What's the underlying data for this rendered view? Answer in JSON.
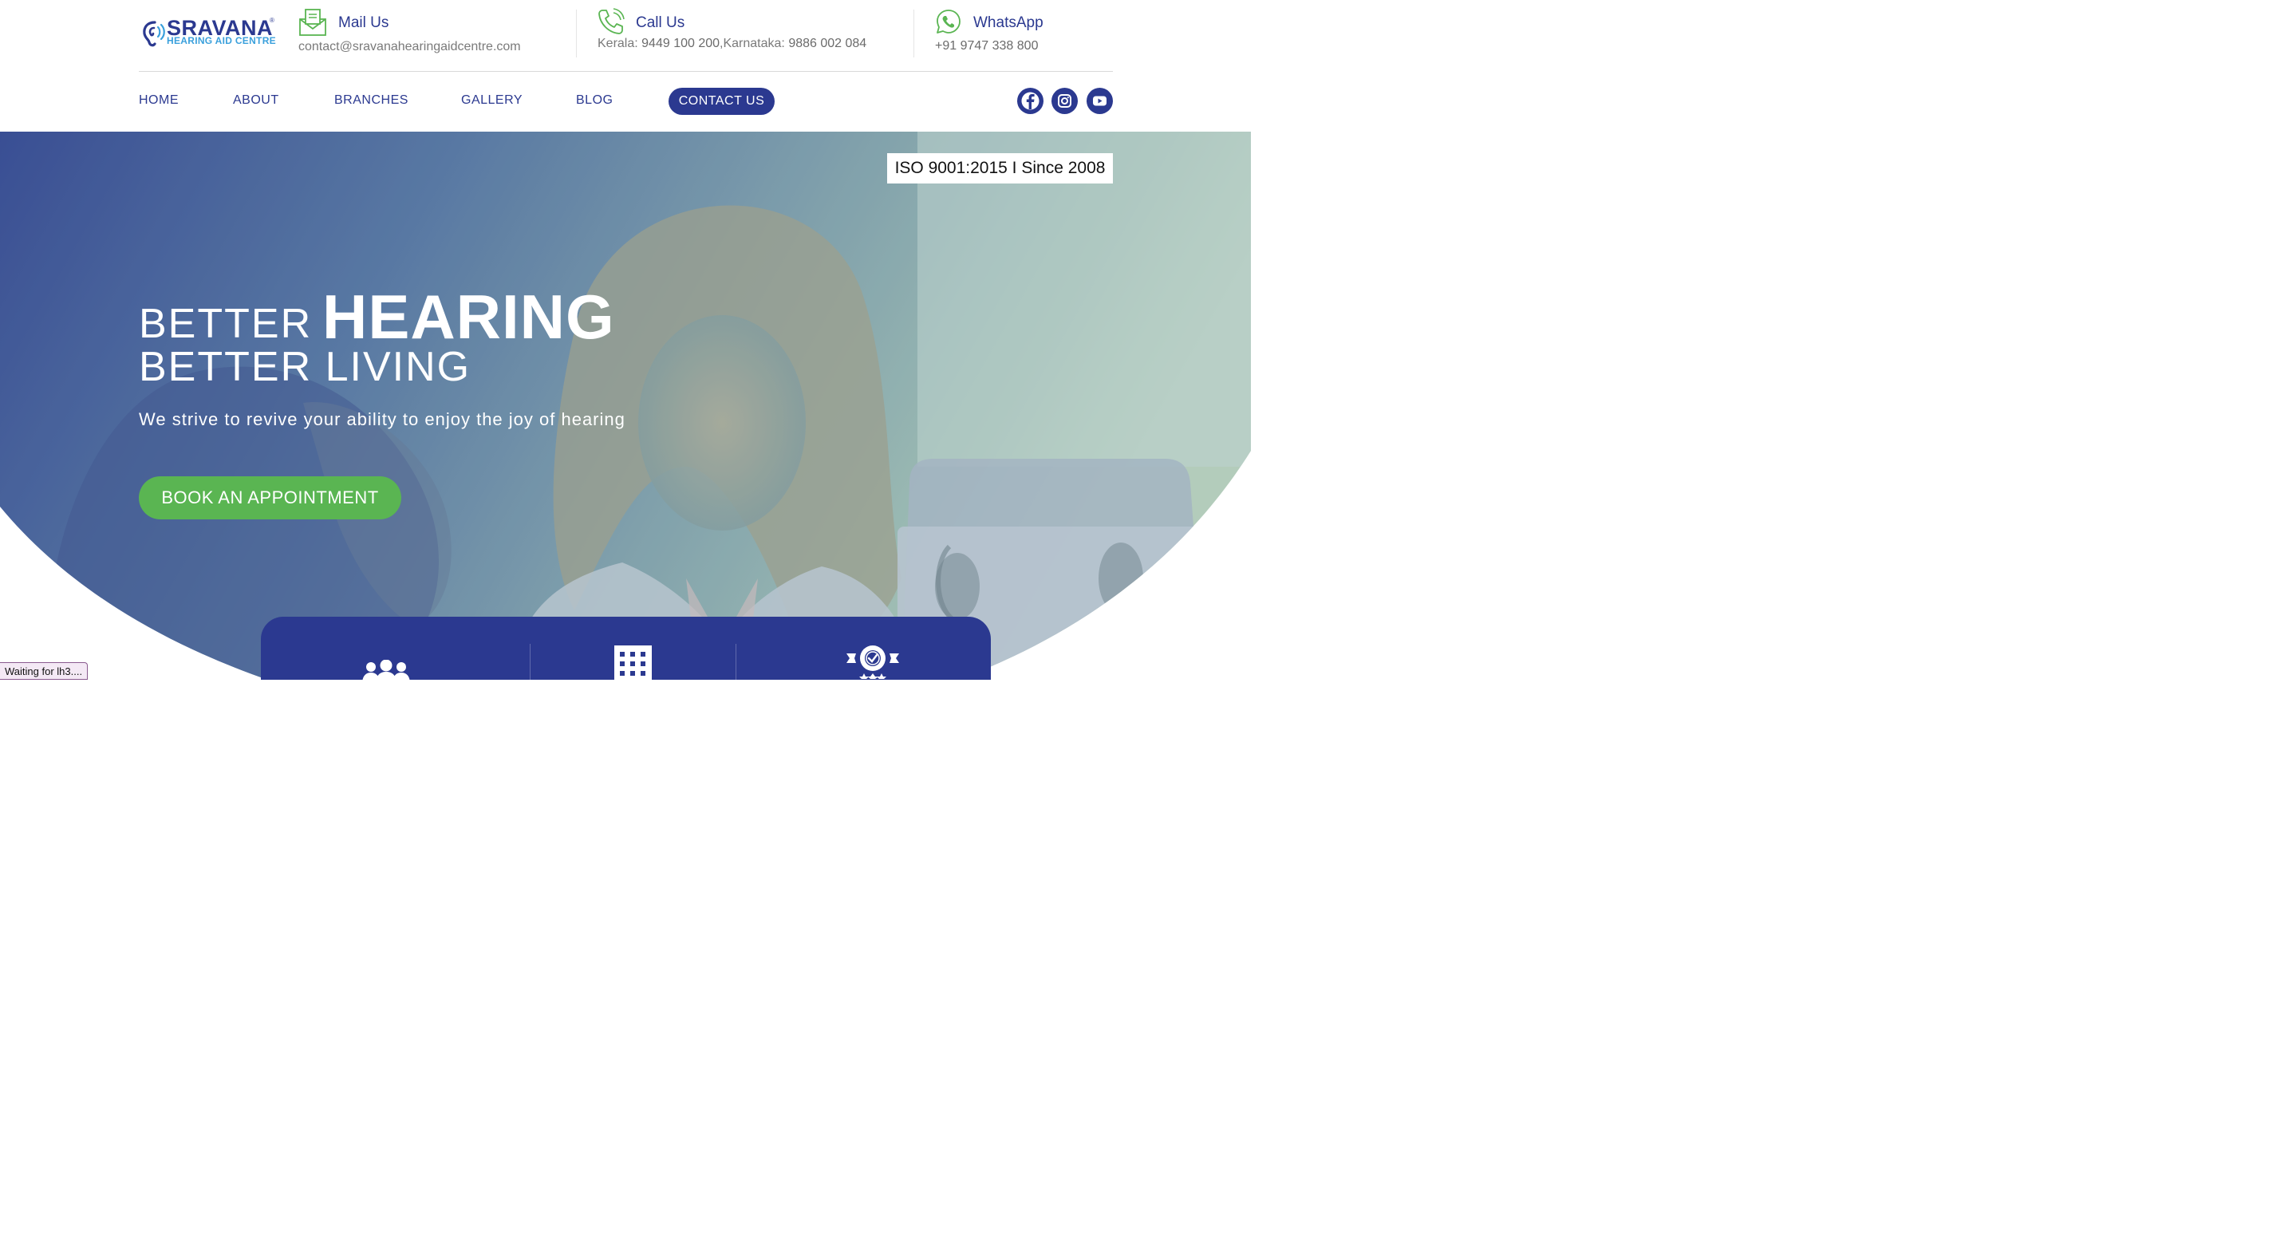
{
  "logo": {
    "name": "SRAVANA",
    "subtitle": "HEARING AID CENTRE",
    "registered": "®"
  },
  "contacts": {
    "mail": {
      "title": "Mail Us",
      "value": "contact@sravanahearingaidcentre.com"
    },
    "call": {
      "title": "Call Us",
      "kerala_label": "Kerala:",
      "kerala_number": "9449 100 200",
      "karnataka_label": ",Karnataka:",
      "karnataka_number": "9886 002 084"
    },
    "whatsapp": {
      "title": "WhatsApp",
      "value": "+91 9747 338 800"
    }
  },
  "nav": {
    "items": [
      "HOME",
      "ABOUT",
      "BRANCHES",
      "GALLERY",
      "BLOG"
    ],
    "cta": "CONTACT US"
  },
  "social": [
    "facebook-icon",
    "instagram-icon",
    "youtube-icon"
  ],
  "hero": {
    "badge": "ISO 9001:2015 I Since 2008",
    "line1_a": "BETTER",
    "line1_b": "HEARING",
    "line2": "BETTER LIVING",
    "tagline": "We strive to revive your ability to enjoy the joy of hearing",
    "button": "BOOK AN APPOINTMENT"
  },
  "features": [
    "people-icon",
    "building-icon",
    "award-badge-icon"
  ],
  "colors": {
    "primary": "#2b3990",
    "green": "#5ab552",
    "accent_blue": "#3aa0dc"
  },
  "status_bar": "Waiting for lh3...."
}
